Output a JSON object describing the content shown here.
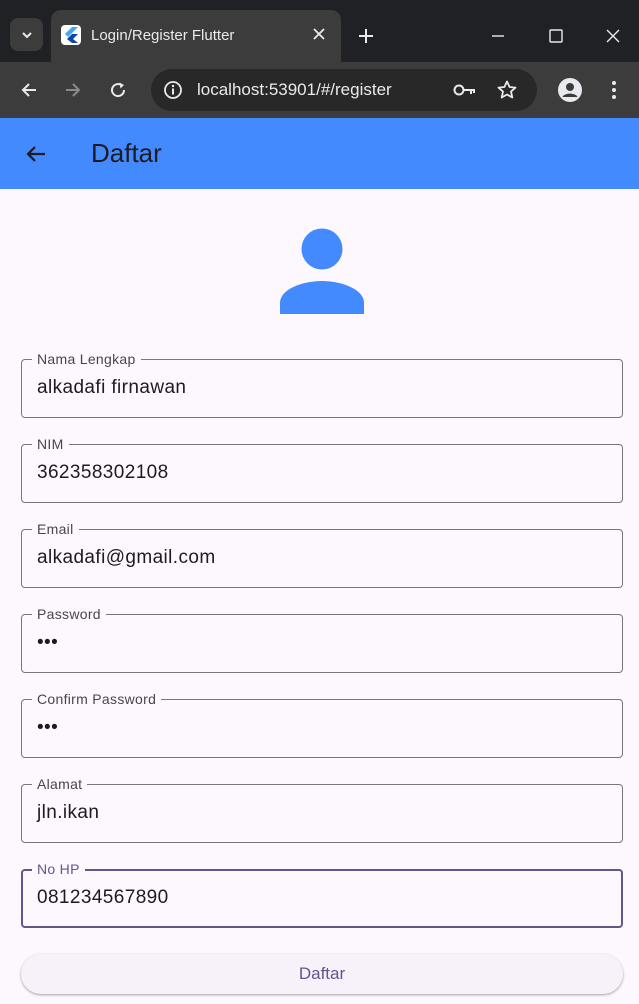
{
  "browser": {
    "tab_title": "Login/Register Flutter",
    "url": "localhost:53901/#/register",
    "icons": {
      "tab_list": "chevron-down-icon",
      "favicon": "flutter-icon",
      "close": "close-icon",
      "new_tab": "plus-icon",
      "minimize": "minimize-icon",
      "maximize": "maximize-icon",
      "window_close": "close-icon",
      "back": "arrow-left-icon",
      "forward": "arrow-right-icon",
      "reload": "reload-icon",
      "site_info": "info-icon",
      "password": "key-icon",
      "bookmark": "star-icon",
      "profile": "account-icon",
      "menu": "more-vert-icon"
    }
  },
  "appbar": {
    "title": "Daftar",
    "back_icon": "arrow-left-icon",
    "color": "#448aff"
  },
  "avatar": {
    "icon": "person-icon",
    "color": "#448aff"
  },
  "form": {
    "fields": [
      {
        "label": "Nama Lengkap",
        "value": "alkadafi firnawan"
      },
      {
        "label": "NIM",
        "value": "362358302108"
      },
      {
        "label": "Email",
        "value": "alkadafi@gmail.com"
      },
      {
        "label": "Password",
        "value": "•••"
      },
      {
        "label": "Confirm Password",
        "value": "•••"
      },
      {
        "label": "Alamat",
        "value": "jln.ikan"
      },
      {
        "label": "No HP",
        "value": "081234567890",
        "focused": true
      }
    ],
    "submit_label": "Daftar",
    "accent": "#65558f"
  }
}
